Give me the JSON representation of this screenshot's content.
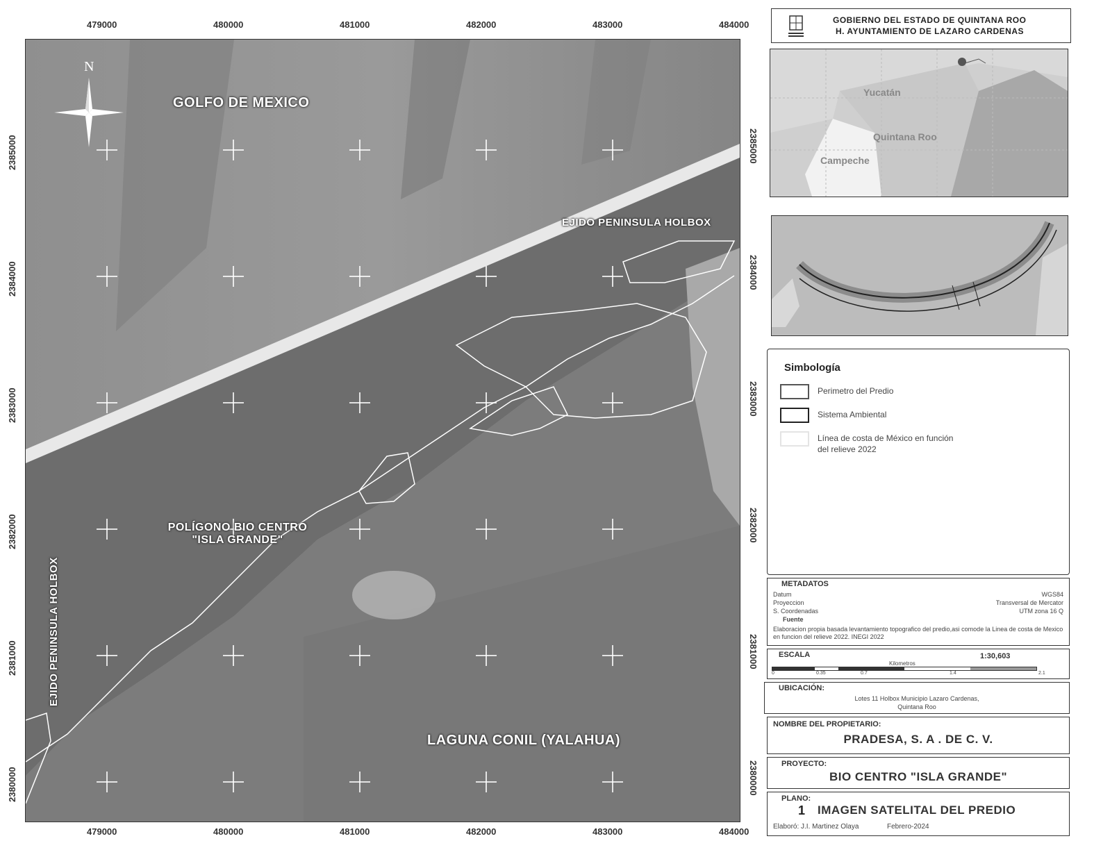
{
  "x_ticks": [
    "479000",
    "480000",
    "481000",
    "482000",
    "483000",
    "484000"
  ],
  "y_ticks": [
    "2385000",
    "2384000",
    "2383000",
    "2382000",
    "2381000",
    "2380000"
  ],
  "map_labels": {
    "north": "N",
    "golfo": "GOLFO DE MEXICO",
    "ejido_top": "EJIDO PENINSULA HOLBOX",
    "ejido_left": "EJIDO PENINSULA HOLBOX",
    "poligono_line1": "POLÍGONO BIO CENTRO",
    "poligono_line2": "\"ISLA GRANDE\"",
    "laguna": "LAGUNA CONIL (YALAHUA)"
  },
  "header": {
    "line1": "GOBIERNO DEL ESTADO DE QUINTANA ROO",
    "line2": "H. AYUNTAMIENTO DE LAZARO CARDENAS"
  },
  "inset_states": {
    "yucatan": "Yucatán",
    "quintana_roo": "Quintana Roo",
    "campeche": "Campeche"
  },
  "legend": {
    "title": "Simbología",
    "items": [
      {
        "label": "Perimetro del Predio",
        "color": "#555555"
      },
      {
        "label": "Sistema Ambiental",
        "color": "#222222"
      },
      {
        "label": "Línea de costa de México en función del relieve 2022",
        "color": "#e4e4e4"
      }
    ]
  },
  "metadatos": {
    "title": "METADATOS",
    "datum_label": "Datum",
    "datum_value": "WGS84",
    "proyeccion_label": "Proyeccion",
    "proyeccion_value": "Transversal de Mercator",
    "coords_label": "S. Coordenadas",
    "coords_value": "UTM zona 16 Q",
    "fuente_label": "Fuente",
    "fuente_text": "Elaboracion propia basada levantamiento topografico del predio,asi comode la Linea de costa de Mexico en funcion del relieve 2022. INEGI 2022"
  },
  "escala": {
    "title": "ESCALA",
    "ratio": "1:30,603",
    "unit": "Kilometros",
    "ticks": [
      "0",
      "0.35",
      "0.7",
      "1.4",
      "2.1"
    ]
  },
  "ubicacion": {
    "title": "UBICACIÓN:",
    "line1": "Lotes 11 Holbox Municipio Lazaro Cardenas,",
    "line2": "Quintana Roo"
  },
  "propietario": {
    "title": "NOMBRE DEL PROPIETARIO:",
    "value": "PRADESA, S. A . DE C. V."
  },
  "proyecto": {
    "title": "PROYECTO:",
    "value": "BIO CENTRO \"ISLA GRANDE\""
  },
  "plano": {
    "title": "PLANO:",
    "number": "1",
    "value": "IMAGEN SATELITAL DEL PREDIO",
    "elaboro": "Elaboró: J.I. Martinez Olaya",
    "fecha": "Febrero-2024"
  },
  "colors": {
    "sea": "#8a8a8a",
    "lagoon": "#7a7a7a",
    "land": "#6b6b6b",
    "beach": "#e6e6e6"
  }
}
